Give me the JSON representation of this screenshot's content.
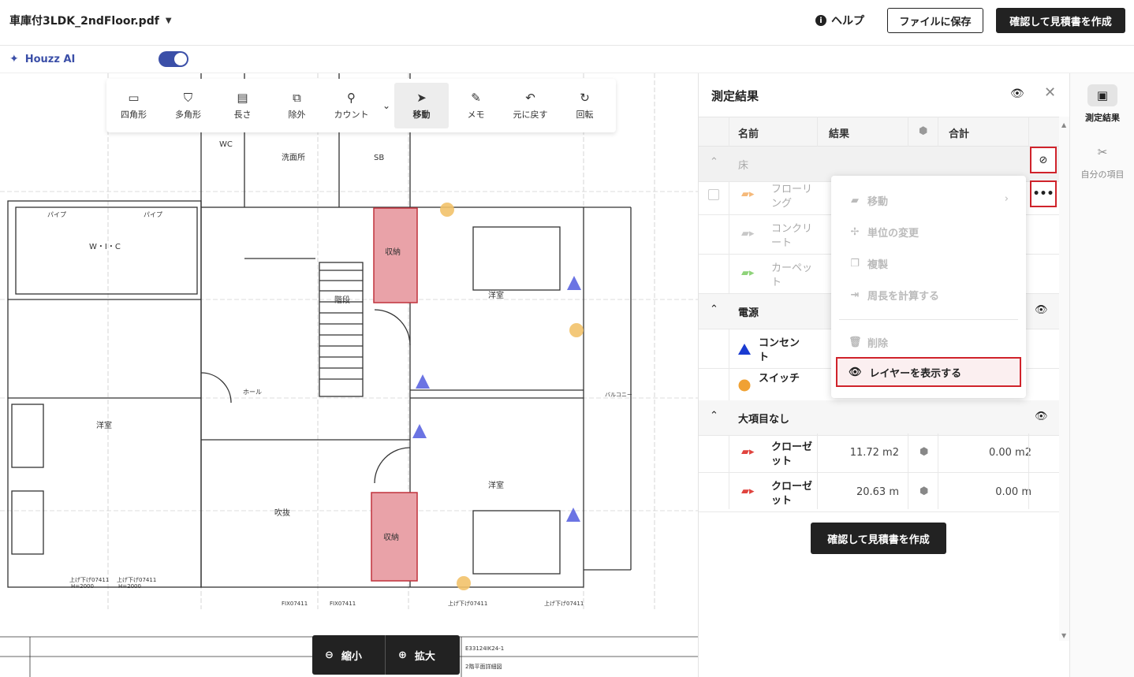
{
  "header": {
    "file_name": "車庫付3LDK_2ndFloor.pdf",
    "help": "ヘルプ",
    "save_to_file": "ファイルに保存",
    "confirm_estimate": "確認して見積書を作成"
  },
  "ai": {
    "label": "Houzz AI",
    "toggle_on": true
  },
  "toolbar": {
    "tools": [
      {
        "label": "四角形",
        "icon": "rectangle-icon"
      },
      {
        "label": "多角形",
        "icon": "polygon-icon"
      },
      {
        "label": "長さ",
        "icon": "ruler-icon"
      },
      {
        "label": "除外",
        "icon": "exclude-icon"
      },
      {
        "label": "カウント",
        "icon": "count-icon"
      },
      {
        "label": "移動",
        "icon": "pointer-icon",
        "active": true
      },
      {
        "label": "メモ",
        "icon": "pen-icon"
      },
      {
        "label": "元に戻す",
        "icon": "undo-icon"
      },
      {
        "label": "回転",
        "icon": "rotate-icon"
      }
    ]
  },
  "zoom": {
    "out": "縮小",
    "in": "拡大"
  },
  "plan_labels": {
    "wc": "WC",
    "washroom": "洗面所",
    "sb": "SB",
    "wic": "W・I・C",
    "storage": "収納",
    "stairs": "階段",
    "western_room": "洋室",
    "hall": "ホール",
    "atrium": "吹抜",
    "balcony": "バルコニー",
    "pipe": "パイプ",
    "window_a": "上げ下げ07411",
    "h2000": "H=2000",
    "fix": "FIX07411",
    "code": "E33124IK24-1",
    "sheet": "2階平面詳細図"
  },
  "panel": {
    "title": "測定結果",
    "columns": {
      "name": "名前",
      "result": "結果",
      "total": "合計"
    },
    "groups": [
      {
        "name": "床",
        "items": [
          {
            "name": "フローリング",
            "color": "#f5b97a"
          },
          {
            "name": "コンクリート",
            "color": "#c8c8c8"
          },
          {
            "name": "カーペット",
            "color": "#8fd37a"
          }
        ]
      },
      {
        "name": "電源",
        "items": [
          {
            "name": "コンセント",
            "symbol": "triangle",
            "color": "#1a3bd1"
          },
          {
            "name": "スイッチ",
            "symbol": "circle",
            "color": "#f0a133"
          }
        ]
      },
      {
        "name": "大項目なし",
        "items": [
          {
            "name": "クローゼット",
            "result": "11.72 m2",
            "total": "0.00 m2",
            "color": "#e0443f"
          },
          {
            "name": "クローゼット",
            "result": "20.63 m",
            "total": "0.00 m",
            "color": "#e0443f"
          }
        ]
      }
    ],
    "cta": "確認して見積書を作成"
  },
  "context_menu": {
    "items": [
      "移動",
      "単位の変更",
      "複製",
      "周長を計算する",
      "削除"
    ],
    "show_layer": "レイヤーを表示する"
  },
  "rail": {
    "items": [
      {
        "label": "測定結果",
        "icon": "layout-icon",
        "active": true
      },
      {
        "label": "自分の項目",
        "icon": "tools-icon",
        "active": false
      }
    ]
  }
}
